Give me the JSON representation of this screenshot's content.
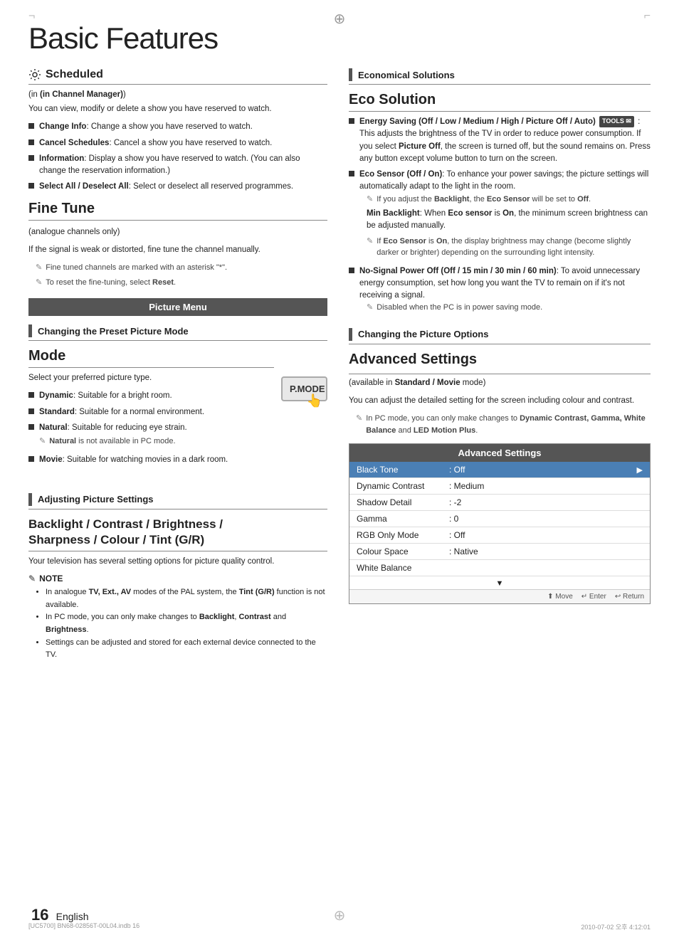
{
  "page": {
    "title": "Basic Features",
    "page_number": "16",
    "language": "English"
  },
  "footer": {
    "left": "[UC5700] BN68-02856T-00L04.indb   16",
    "right": "2010-07-02   오후 4:12:01"
  },
  "left": {
    "scheduled": {
      "heading": "Scheduled",
      "in_label": "(in Channel Manager)",
      "body": "You can view, modify or delete a show you have reserved to watch.",
      "items": [
        {
          "label": "Change Info",
          "desc": ": Change a show you have reserved to watch."
        },
        {
          "label": "Cancel Schedules",
          "desc": ": Cancel a show you have reserved to watch."
        },
        {
          "label": "Information",
          "desc": ": Display a show you have reserved to watch. (You can also change the reservation information.)"
        },
        {
          "label": "Select All / Deselect All",
          "desc": ": Select or deselect all reserved programmes."
        }
      ]
    },
    "fine_tune": {
      "heading": "Fine Tune",
      "subtitle": "(analogue channels only)",
      "body": "If the signal is weak or distorted, fine tune the channel manually.",
      "notes": [
        "Fine tuned channels are marked with an asterisk \"*\".",
        "To reset the fine-tuning, select Reset."
      ]
    },
    "picture_menu": {
      "label": "Picture Menu"
    },
    "changing_preset": {
      "section_label": "Changing the Preset Picture Mode"
    },
    "mode": {
      "heading": "Mode",
      "subtitle": "Select your preferred picture type.",
      "pmode_label": "P.MODE",
      "items": [
        {
          "label": "Dynamic",
          "desc": ": Suitable for a bright room."
        },
        {
          "label": "Standard",
          "desc": ": Suitable for a normal environment."
        },
        {
          "label": "Natural",
          "desc": ": Suitable for reducing eye strain."
        },
        {
          "label": "Movie",
          "desc": ": Suitable for watching movies in a dark room."
        }
      ],
      "note": "Natural is not available in PC mode."
    },
    "adjusting": {
      "section_label": "Adjusting Picture Settings"
    },
    "backlight": {
      "heading": "Backlight / Contrast / Brightness / Sharpness / Colour / Tint (G/R)",
      "body": "Your television has several setting options for picture quality control.",
      "note_heading": "NOTE",
      "notes": [
        "In analogue TV, Ext., AV modes of the PAL system, the Tint (G/R) function is not available.",
        "In PC mode, you can only make changes to Backlight, Contrast and Brightness.",
        "Settings can be adjusted and stored for each external device connected to the TV."
      ]
    }
  },
  "right": {
    "economical": {
      "section_label": "Economical Solutions"
    },
    "eco": {
      "heading": "Eco Solution",
      "items": [
        {
          "label": "Energy Saving (Off / Low / Medium / High / Picture Off / Auto)",
          "tools_badge": "TOOLS ✉",
          "desc": ": This adjusts the brightness of the TV in order to reduce power consumption. If you select Picture Off, the screen is turned off, but the sound remains on. Press any button except volume button to turn on the screen."
        },
        {
          "label": "Eco Sensor (Off / On)",
          "desc": ": To enhance your power savings; the picture settings will automatically adapt to the light in the room.",
          "sub_notes": [
            "If you adjust the Backlight, the Eco Sensor will be set to Off.",
            "Min Backlight: When Eco sensor is On, the minimum screen brightness can be adjusted manually.",
            "If Eco Sensor is On, the display brightness may change (become slightly darker or brighter) depending on the surrounding light intensity."
          ]
        },
        {
          "label": "No-Signal Power Off (Off / 15 min / 30 min / 60 min)",
          "desc": ": To avoid unnecessary energy consumption, set how long you want the TV to remain on if it's not receiving a signal.",
          "sub_notes": [
            "Disabled when the PC is in power saving mode."
          ]
        }
      ]
    },
    "changing_options": {
      "section_label": "Changing the Picture Options"
    },
    "advanced_settings": {
      "heading": "Advanced Settings",
      "subtitle": "(available in Standard / Movie mode)",
      "body": "You can adjust the detailed setting for the screen including colour and contrast.",
      "note": "In PC mode, you can only make changes to Dynamic Contrast, Gamma, White Balance and LED Motion Plus.",
      "table_title": "Advanced Settings",
      "rows": [
        {
          "name": "Black Tone",
          "value": ": Off",
          "arrow": "▶",
          "highlighted": true
        },
        {
          "name": "Dynamic Contrast",
          "value": ": Medium",
          "arrow": ""
        },
        {
          "name": "Shadow Detail",
          "value": ": -2",
          "arrow": ""
        },
        {
          "name": "Gamma",
          "value": ": 0",
          "arrow": ""
        },
        {
          "name": "RGB Only Mode",
          "value": ": Off",
          "arrow": ""
        },
        {
          "name": "Colour Space",
          "value": ": Native",
          "arrow": ""
        },
        {
          "name": "White Balance",
          "value": "",
          "arrow": ""
        }
      ],
      "table_footer_down": "▼",
      "footer_items": [
        "⬆ Move",
        "↵ Enter",
        "↩ Return"
      ]
    }
  }
}
